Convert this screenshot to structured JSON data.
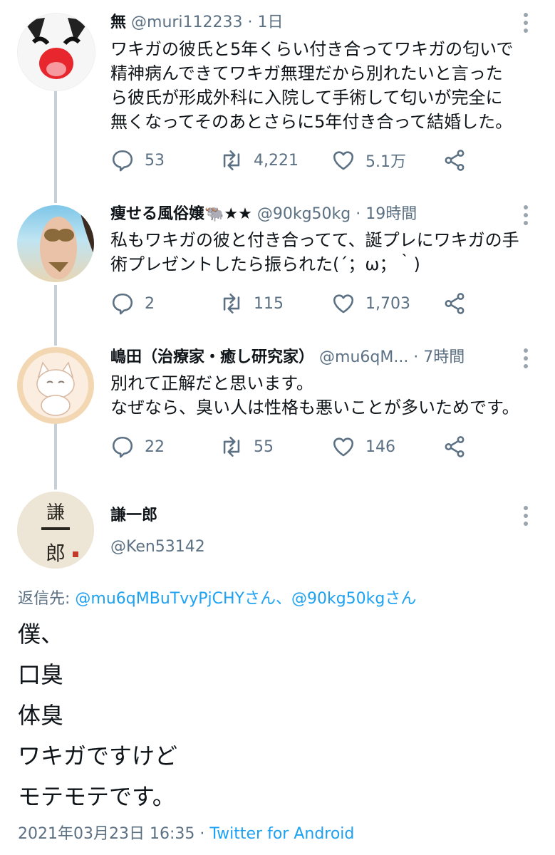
{
  "tweets": [
    {
      "name": "無",
      "handle": "@muri112233",
      "time": "1日",
      "lines": [
        "ワキガの彼氏と5年くらい付き合ってワキガの匂いで",
        "精神病んできてワキガ無理だから別れたいと言った",
        "ら彼氏が形成外科に入院して手術して匂いが完全に",
        "無くなってそのあとさらに5年付き合って結婚した。"
      ],
      "replies": "53",
      "retweets": "4,221",
      "likes": "5.1万"
    },
    {
      "name": "痩せる風俗嬢🐃★★",
      "handle": "@90kg50kg",
      "time": "19時間",
      "lines": [
        "私もワキガの彼と付き合ってて、誕プレにワキガの手",
        "術プレゼントしたら振られた(´；ω；｀)"
      ],
      "replies": "2",
      "retweets": "115",
      "likes": "1,703"
    },
    {
      "name": "嶋田（治療家・癒し研究家）",
      "handle": "@mu6qM...",
      "time": "7時間",
      "lines": [
        "別れて正解だと思います。",
        "なぜなら、臭い人は性格も悪いことが多いためです。"
      ],
      "replies": "22",
      "retweets": "55",
      "likes": "146"
    }
  ],
  "main": {
    "name": "謙一郎",
    "handle": "@Ken53142",
    "reply_prefix": "返信先: ",
    "reply_to": "@mu6qMBuTvyPjCHYさん、@90kg50kgさん",
    "lines": [
      "僕、",
      "口臭",
      "体臭",
      "ワキガですけど",
      "モテモテです。"
    ],
    "timestamp": "2021年03月23日 16:35 · ",
    "client": "Twitter for Android",
    "avatar_text": "謙一郎"
  },
  "separator": " · ",
  "colors": {
    "link": "#1da1f2",
    "muted": "#5b7083",
    "thread_line": "#c8d0d6"
  },
  "icons": [
    "reply-icon",
    "retweet-icon",
    "like-icon",
    "share-icon",
    "more-icon"
  ]
}
